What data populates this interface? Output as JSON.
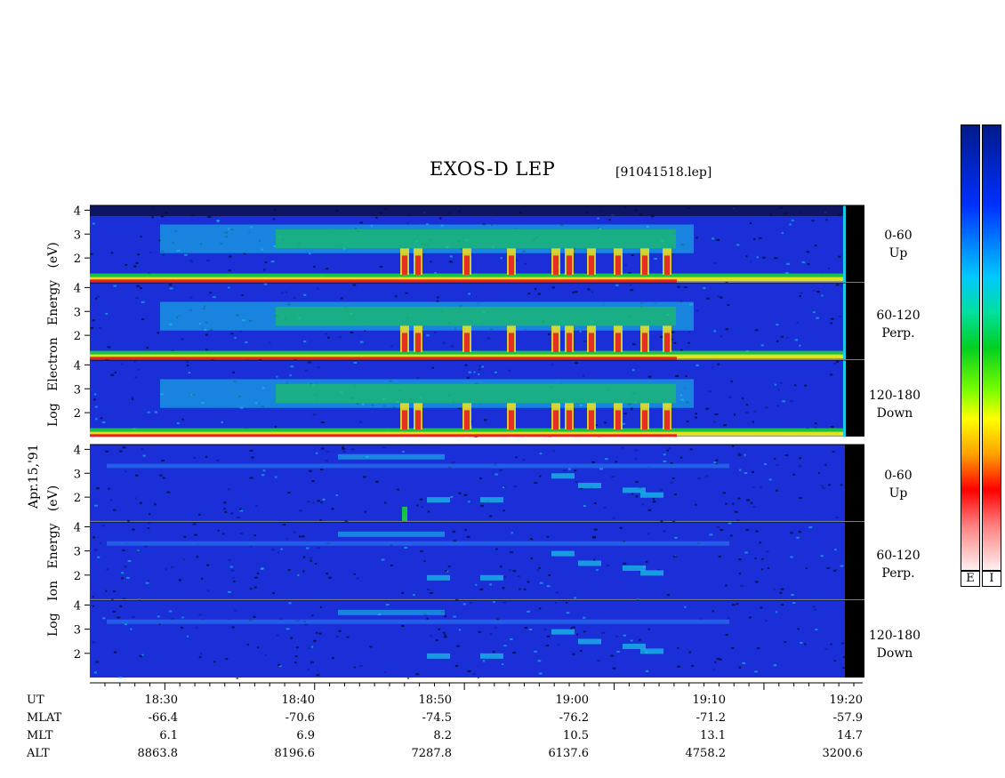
{
  "header": {
    "title": "EXOS-D LEP",
    "file": "[91041518.lep]"
  },
  "date_label": "Apr.15,'91",
  "electron_group": {
    "label_parts": [
      "Log",
      "Electron",
      "Energy",
      "(eV)"
    ]
  },
  "ion_group": {
    "label_parts": [
      "Log",
      "Ion",
      "Energy",
      "(eV)"
    ]
  },
  "angle_labels": [
    {
      "range": "0-60",
      "dir": "Up"
    },
    {
      "range": "60-120",
      "dir": "Perp."
    },
    {
      "range": "120-180",
      "dir": "Down"
    },
    {
      "range": "0-60",
      "dir": "Up"
    },
    {
      "range": "60-120",
      "dir": "Perp."
    },
    {
      "range": "120-180",
      "dir": "Down"
    }
  ],
  "colorbars": [
    {
      "tag": "E"
    },
    {
      "tag": "I"
    }
  ],
  "colors": {
    "background_noise": "#1a2fd8",
    "cold_core": "#1740e0",
    "green": "#19d13a",
    "yellow": "#f5e51a",
    "red": "#e8141e",
    "cyan": "#19c9e8"
  },
  "ephemeris": {
    "rows": [
      {
        "name": "UT",
        "values": [
          "18:30",
          "18:40",
          "18:50",
          "19:00",
          "19:10",
          "19:20"
        ]
      },
      {
        "name": "MLAT",
        "values": [
          "-66.4",
          "-70.6",
          "-74.5",
          "-76.2",
          "-71.2",
          "-57.9"
        ]
      },
      {
        "name": "MLT",
        "values": [
          "6.1",
          "6.9",
          "8.2",
          "10.5",
          "13.1",
          "14.7"
        ]
      },
      {
        "name": "ALT",
        "values": [
          "8863.8",
          "8196.6",
          "7287.8",
          "6137.6",
          "4758.2",
          "3200.6"
        ]
      }
    ]
  },
  "chart_data": {
    "type": "heatmap",
    "title": "EXOS-D LEP",
    "xlabel": "UT",
    "ylabel": "Log Energy (eV)",
    "x_ticks": [
      "18:30",
      "18:40",
      "18:50",
      "19:00",
      "19:10",
      "19:20"
    ],
    "y_ticks": [
      "4",
      "3",
      "2"
    ],
    "ylim": [
      1,
      4.2
    ],
    "panels": [
      {
        "species": "Electron",
        "pitch": "0-60 Up"
      },
      {
        "species": "Electron",
        "pitch": "60-120 Perp."
      },
      {
        "species": "Electron",
        "pitch": "120-180 Down"
      },
      {
        "species": "Ion",
        "pitch": "0-60 Up"
      },
      {
        "species": "Ion",
        "pitch": "60-120 Perp."
      },
      {
        "species": "Ion",
        "pitch": "120-180 Down"
      }
    ]
  }
}
